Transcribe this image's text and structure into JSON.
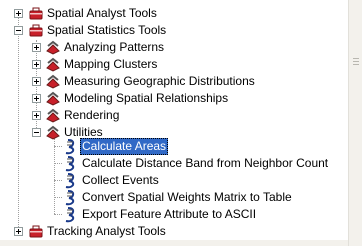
{
  "tree": {
    "items": [
      {
        "label": "Spatial Analyst Tools"
      },
      {
        "label": "Spatial Statistics Tools"
      },
      {
        "label": "Analyzing Patterns"
      },
      {
        "label": "Mapping Clusters"
      },
      {
        "label": "Measuring Geographic Distributions"
      },
      {
        "label": "Modeling Spatial Relationships"
      },
      {
        "label": "Rendering"
      },
      {
        "label": "Utilities"
      },
      {
        "label": "Calculate Areas"
      },
      {
        "label": "Calculate Distance Band from Neighbor Count"
      },
      {
        "label": "Collect Events"
      },
      {
        "label": "Convert Spatial Weights Matrix to Table"
      },
      {
        "label": "Export Feature Attribute to ASCII"
      },
      {
        "label": "Tracking Analyst Tools"
      }
    ],
    "selected_index": 8
  },
  "icons": {
    "toolbox": "toolbox-icon",
    "toolset": "toolset-icon",
    "script": "script-tool-icon"
  },
  "colors": {
    "selection": "#3169c6",
    "toolbox_red": "#c8202a"
  }
}
